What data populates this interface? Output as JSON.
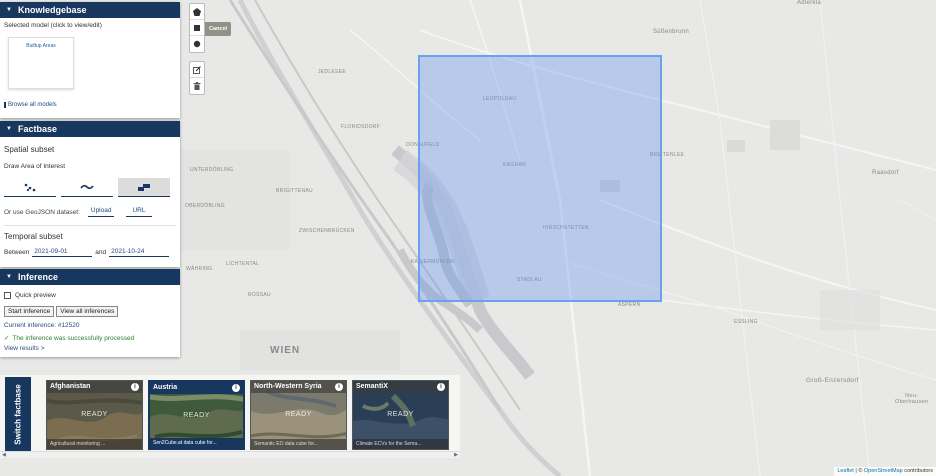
{
  "map": {
    "places": {
      "adlerkla": "Adlerkla",
      "sussenbrunn": "Süßenbrunn",
      "jedlesee": "JEDLESEE",
      "leopoldau": "LEOPOLDAU",
      "floridsdorf": "FLORIDSDORF",
      "donaufeld": "DONAUFELD",
      "kagran": "KAGRAN",
      "breitenlee": "BREITENLEE",
      "raasdorf": "Raasdorf",
      "unterdobling": "UNTERDÖBLING",
      "brigittenau": "BRIGITTENAU",
      "oberdobling": "OBERDÖBLING",
      "zwischenbrucken": "ZWISCHENBRÜCKEN",
      "hirschstetten": "HIRSCHSTETTEN",
      "kaisermuhlen": "KAISERMÜHLEN",
      "stadlau": "STADLAU",
      "wahring": "WÄHRING",
      "lichtental": "LICHTENTAL",
      "rossau": "ROSSAU",
      "aspern": "ASPERN",
      "essling": "ESSLING",
      "wien": "WIEN",
      "groll_enzersdorf": "Groß-Enzersdorf",
      "neu_oberhausen": "Neu-\nOberhausen"
    }
  },
  "draw": {
    "cancel_label": "Cancel"
  },
  "knowledgebase": {
    "title": "Knowledgebase",
    "selected_label": "Selected model (click to view/edit)",
    "model_name": "Builtup Areas",
    "browse_label": "Browse all models"
  },
  "factbase": {
    "title": "Factbase",
    "spatial_title": "Spatial subset",
    "aoi_label": "Draw Area of Interest",
    "geojson_label": "Or use GeoJSON dataset:",
    "upload_label": "Upload",
    "url_label": "URL",
    "temporal_title": "Temporal subset",
    "between_label": "Between",
    "date_from": "2021-09-01",
    "and_label": "and",
    "date_to": "2021-10-24"
  },
  "inference": {
    "title": "Inference",
    "quick_preview": "Quick preview",
    "start_label": "Start inference",
    "view_all_label": "View all inferences",
    "current": "Current inference: #12520",
    "success": "The inference was successfully processed",
    "view_results": "View results >"
  },
  "switch_factbase": {
    "label": "Switch factbase",
    "cards": [
      {
        "title": "Afghanistan",
        "ready": "READY",
        "desc": "Agricultural monitoring ..."
      },
      {
        "title": "Austria",
        "ready": "READY",
        "desc": "Sen2Cube.at data cube for..."
      },
      {
        "title": "North-Western Syria",
        "ready": "READY",
        "desc": "Semantic EO data cube for..."
      },
      {
        "title": "SemantiX",
        "ready": "READY",
        "desc": "Climate ECVs for the Sema..."
      }
    ]
  },
  "attribution": {
    "leaflet": "Leaflet",
    "sep": " | © ",
    "osm": "OpenStreetMap",
    "rest": " contributors"
  },
  "colors": {
    "panel_header": "#17375e",
    "aoi_fill": "#6699ee",
    "map_bg": "#e8e8e6"
  }
}
